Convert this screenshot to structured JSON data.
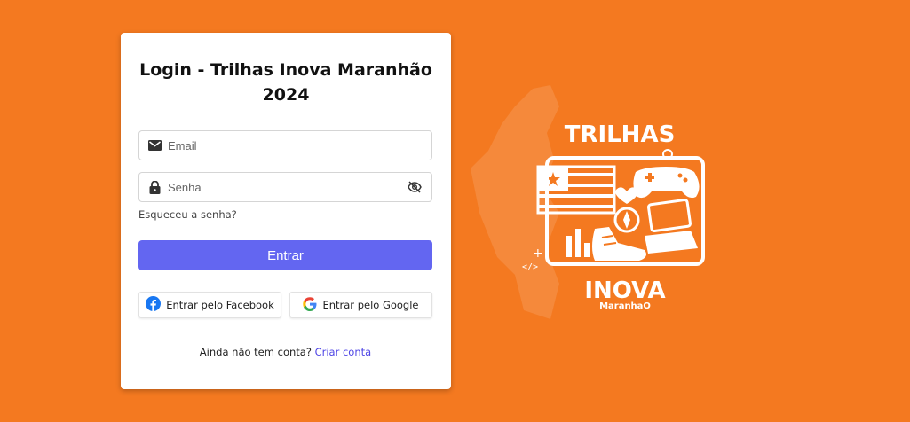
{
  "login": {
    "title": "Login - Trilhas Inova Maranhão 2024",
    "email_placeholder": "Email",
    "password_placeholder": "Senha",
    "forgot_password": "Esqueceu a senha?",
    "submit_label": "Entrar",
    "facebook_label": "Entrar pelo Facebook",
    "google_label": "Entrar pelo Google",
    "signup_prompt": "Ainda não tem conta?",
    "signup_link": "Criar conta"
  },
  "brand": {
    "top_text": "TRILHAS",
    "bottom_text": "INOVA",
    "sub_text": "MaranhaO"
  },
  "colors": {
    "background": "#f47920",
    "primary": "#6366f1",
    "link": "#4f46e5"
  },
  "icons": {
    "email": "envelope-icon",
    "password": "lock-icon",
    "toggle_visibility": "eye-off-icon",
    "facebook": "facebook-icon",
    "google": "google-icon"
  }
}
